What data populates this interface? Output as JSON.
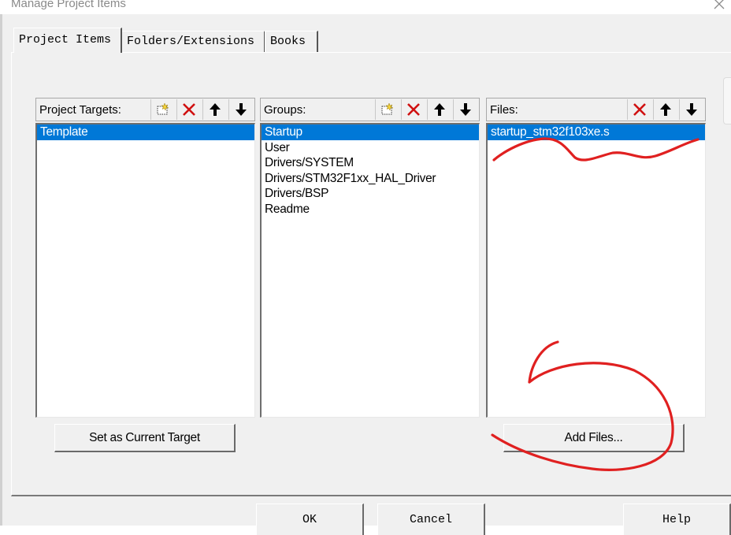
{
  "window": {
    "title": "Manage Project Items",
    "close_icon": "close-icon"
  },
  "tabs": [
    {
      "label": "Project Items",
      "active": true
    },
    {
      "label": "Folders/Extensions",
      "active": false
    },
    {
      "label": "Books",
      "active": false
    }
  ],
  "targets": {
    "label": "Project Targets:",
    "items": [
      "Template"
    ],
    "selected": "Template",
    "toolbar": [
      "new-icon",
      "delete-icon",
      "move-up-icon",
      "move-down-icon"
    ]
  },
  "groups": {
    "label": "Groups:",
    "items": [
      "Startup",
      "User",
      "Drivers/SYSTEM",
      "Drivers/STM32F1xx_HAL_Driver",
      "Drivers/BSP",
      "Readme"
    ],
    "selected": "Startup",
    "toolbar": [
      "new-icon",
      "delete-icon",
      "move-up-icon",
      "move-down-icon"
    ]
  },
  "files": {
    "label": "Files:",
    "items": [
      "startup_stm32f103xe.s"
    ],
    "selected": "startup_stm32f103xe.s",
    "toolbar": [
      "delete-icon",
      "move-up-icon",
      "move-down-icon"
    ]
  },
  "buttons": {
    "set_current_target": "Set as Current Target",
    "add_files": "Add Files...",
    "ok": "OK",
    "cancel": "Cancel",
    "help": "Help"
  },
  "colors": {
    "selection": "#0078d7",
    "annotation": "#e02020",
    "dialog_bg": "#f0f0f0"
  }
}
